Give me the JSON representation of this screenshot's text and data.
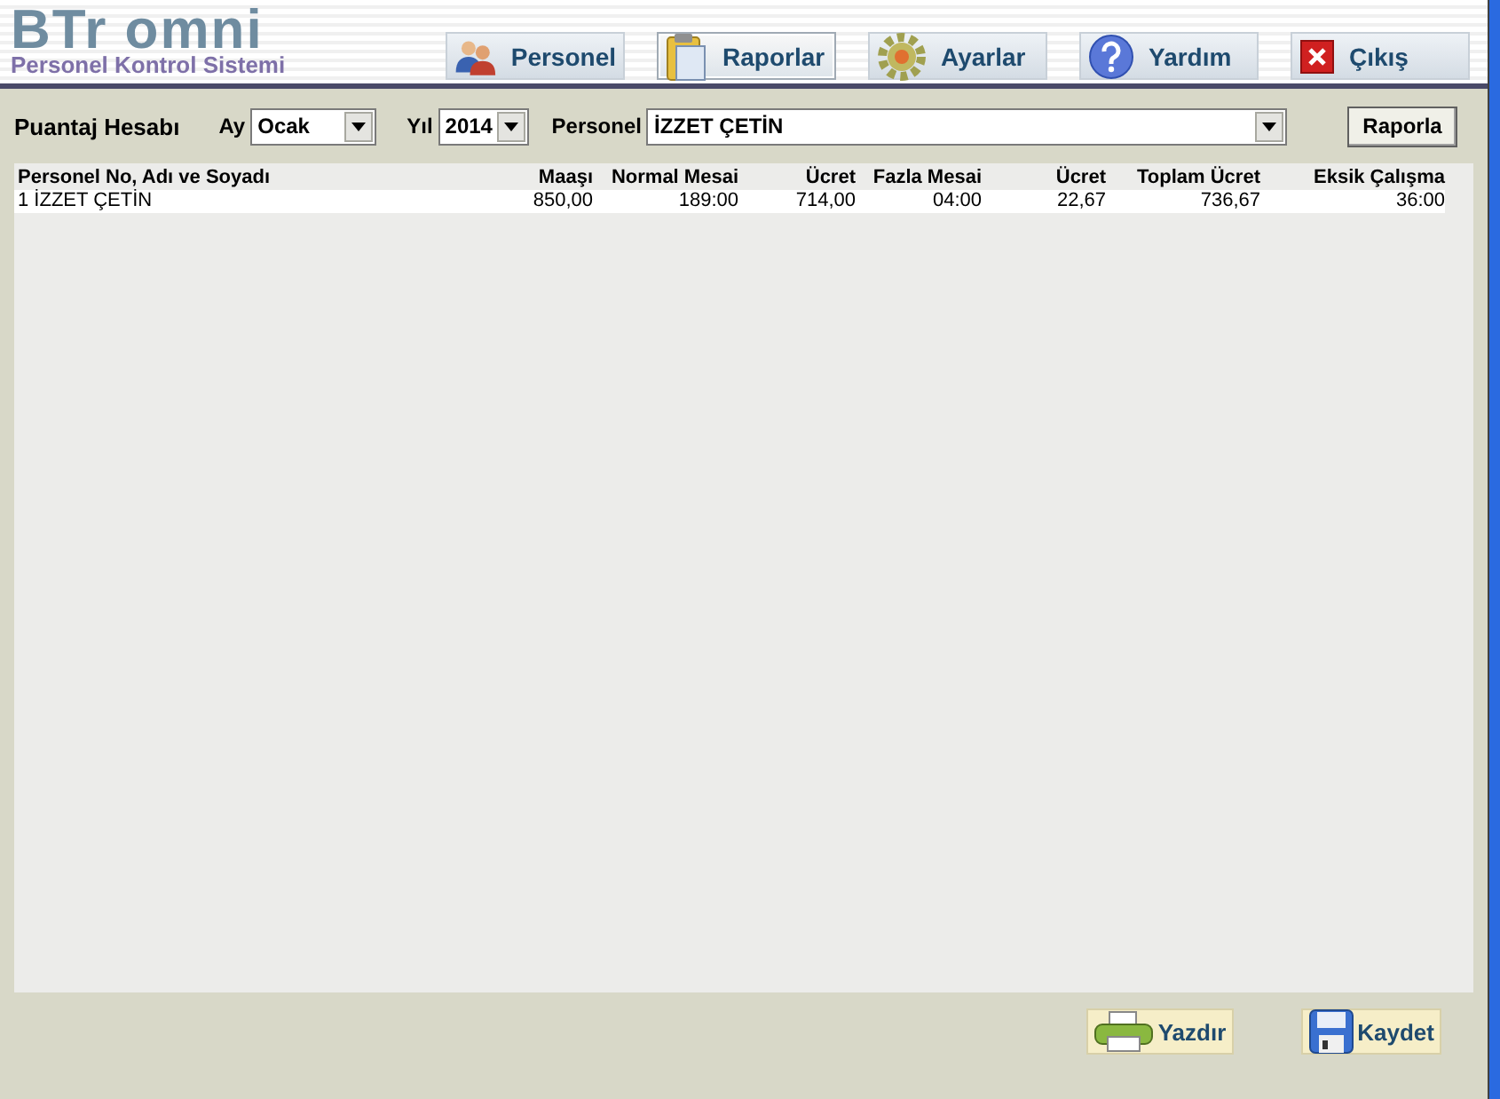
{
  "app": {
    "logo": "BTr omni",
    "subtitle": "Personel Kontrol Sistemi"
  },
  "nav": [
    {
      "label": "Personel",
      "kind": "people",
      "selected": false
    },
    {
      "label": "Raporlar",
      "kind": "clipboard",
      "selected": true
    },
    {
      "label": "Ayarlar",
      "kind": "gear",
      "selected": false
    },
    {
      "label": "Yardım",
      "kind": "help",
      "selected": false
    },
    {
      "label": "Çıkış",
      "kind": "exit",
      "selected": false
    }
  ],
  "filter": {
    "title": "Puantaj Hesabı",
    "month_label": "Ay",
    "month": "Ocak",
    "year_label": "Yıl",
    "year": "2014",
    "person_label": "Personel",
    "person": "İZZET ÇETİN",
    "report_button": "Raporla"
  },
  "table": {
    "columns": [
      "Personel No, Adı ve Soyadı",
      "Maaşı",
      "Normal Mesai",
      "Ücret",
      "Fazla Mesai",
      "Ücret",
      "Toplam Ücret",
      "Eksik Çalışma"
    ],
    "rows": [
      [
        "1 İZZET ÇETİN",
        "850,00",
        "189:00",
        "714,00",
        "04:00",
        "22,67",
        "736,67",
        "36:00"
      ]
    ]
  },
  "actions": [
    {
      "label": "Yazdır",
      "kind": "printer"
    },
    {
      "label": "Kaydet",
      "kind": "floppy"
    }
  ]
}
